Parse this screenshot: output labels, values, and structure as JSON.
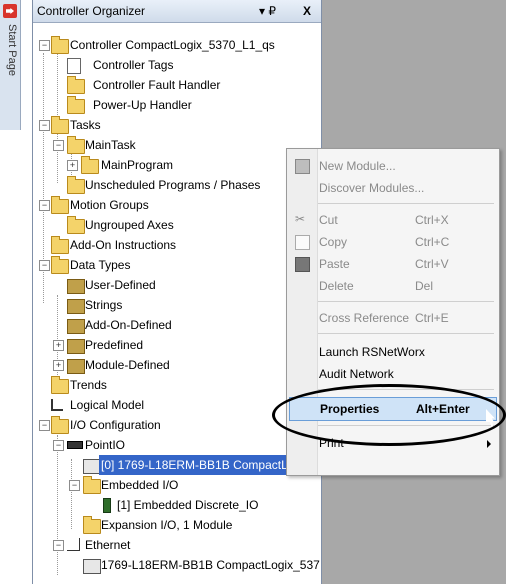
{
  "start_page": {
    "label": "Start Page"
  },
  "organizer": {
    "title": "Controller Organizer",
    "pin_symbol": "▾ ₽",
    "close_symbol": "X",
    "tree": [
      {
        "label": "Controller CompactLogix_5370_L1_qs"
      },
      {
        "label": "Controller Tags"
      },
      {
        "label": "Controller Fault Handler"
      },
      {
        "label": "Power-Up Handler"
      },
      {
        "label": "Tasks"
      },
      {
        "label": "MainTask"
      },
      {
        "label": "MainProgram"
      },
      {
        "label": "Unscheduled Programs / Phases"
      },
      {
        "label": "Motion Groups"
      },
      {
        "label": "Ungrouped Axes"
      },
      {
        "label": "Add-On Instructions"
      },
      {
        "label": "Data Types"
      },
      {
        "label": "User-Defined"
      },
      {
        "label": "Strings"
      },
      {
        "label": "Add-On-Defined"
      },
      {
        "label": "Predefined"
      },
      {
        "label": "Module-Defined"
      },
      {
        "label": "Trends"
      },
      {
        "label": "Logical Model"
      },
      {
        "label": "I/O Configuration"
      },
      {
        "label": "PointIO"
      },
      {
        "label": "[0] 1769-L18ERM-BB1B CompactLog"
      },
      {
        "label": "Embedded I/O"
      },
      {
        "label": "[1] Embedded Discrete_IO"
      },
      {
        "label": "Expansion I/O, 1 Module"
      },
      {
        "label": "Ethernet"
      },
      {
        "label": "1769-L18ERM-BB1B CompactLogix_537"
      }
    ]
  },
  "context_menu": {
    "items": [
      {
        "label": "New Module...",
        "shortcut": ""
      },
      {
        "label": "Discover Modules...",
        "shortcut": ""
      },
      {
        "label": "Cut",
        "shortcut": "Ctrl+X"
      },
      {
        "label": "Copy",
        "shortcut": "Ctrl+C"
      },
      {
        "label": "Paste",
        "shortcut": "Ctrl+V"
      },
      {
        "label": "Delete",
        "shortcut": "Del"
      },
      {
        "label": "Cross Reference",
        "shortcut": "Ctrl+E"
      },
      {
        "label": "Launch RSNetWorx",
        "shortcut": ""
      },
      {
        "label": "Audit Network",
        "shortcut": ""
      },
      {
        "label": "Properties",
        "shortcut": "Alt+Enter"
      },
      {
        "label": "Print",
        "shortcut": ""
      }
    ]
  }
}
